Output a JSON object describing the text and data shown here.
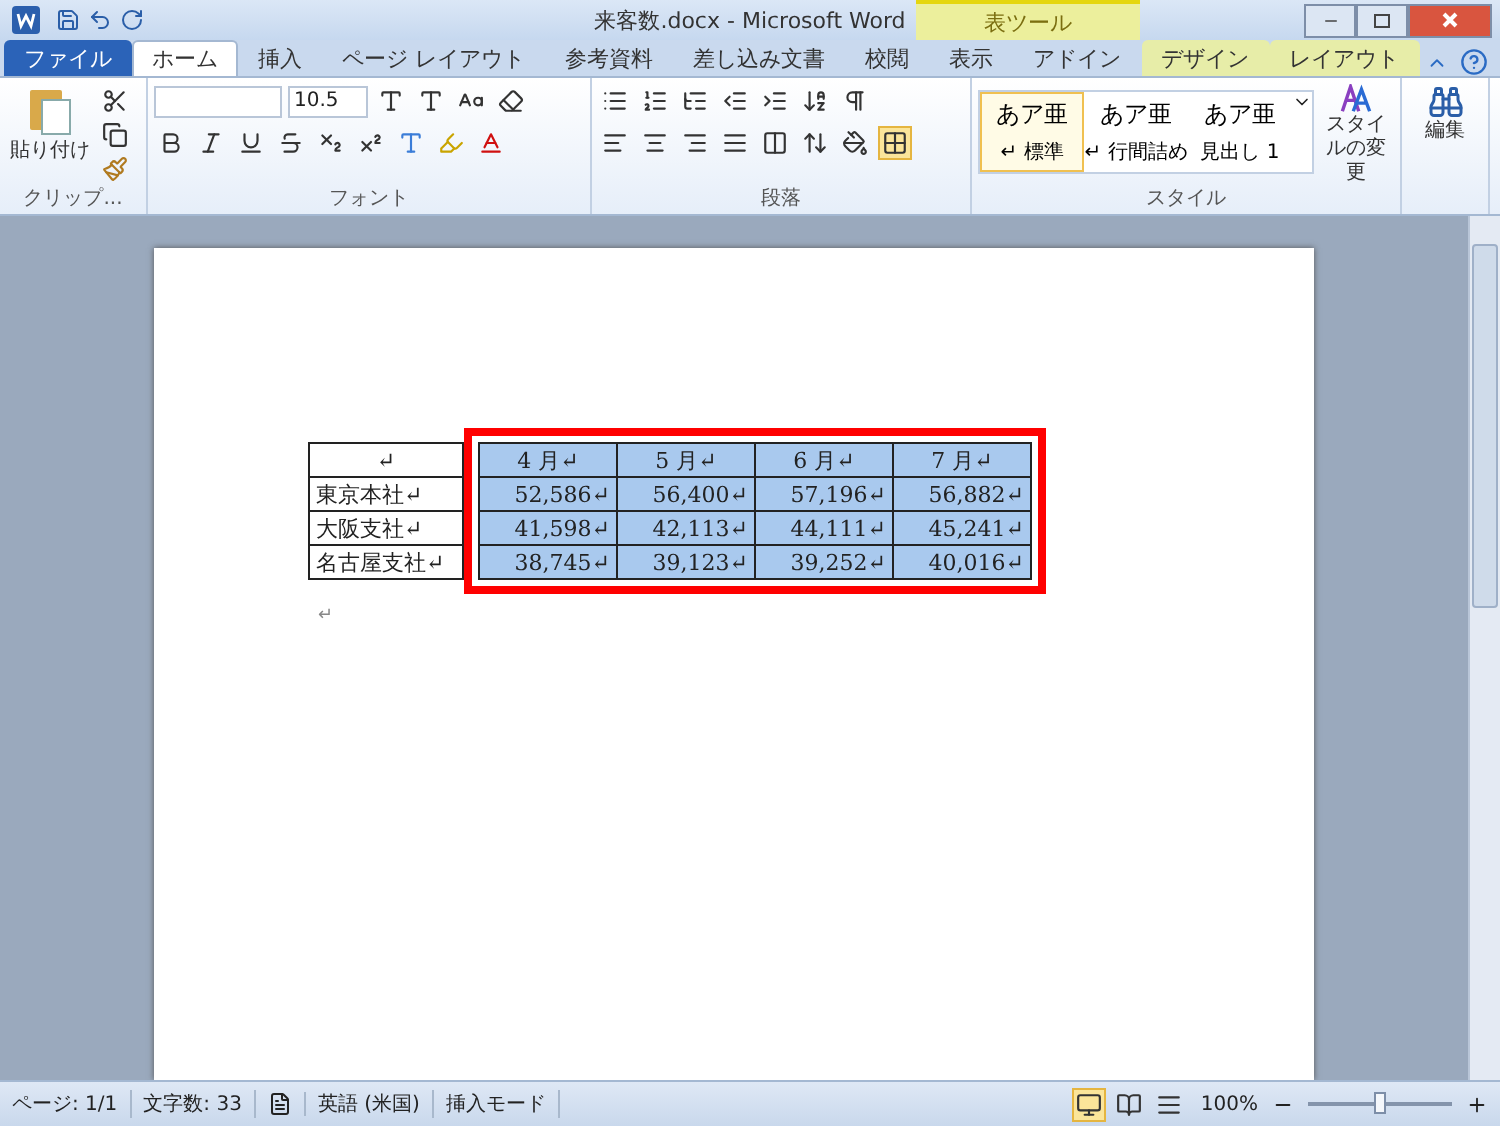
{
  "window": {
    "title": "来客数.docx - Microsoft Word"
  },
  "contextual_header": {
    "label": "表ツール"
  },
  "tabs": [
    {
      "label": "ファイル",
      "kind": "file",
      "selected": false
    },
    {
      "label": "ホーム",
      "kind": "normal",
      "selected": true
    },
    {
      "label": "挿入",
      "kind": "normal",
      "selected": false
    },
    {
      "label": "ページ レイアウト",
      "kind": "normal",
      "selected": false
    },
    {
      "label": "参考資料",
      "kind": "normal",
      "selected": false
    },
    {
      "label": "差し込み文書",
      "kind": "normal",
      "selected": false
    },
    {
      "label": "校閲",
      "kind": "normal",
      "selected": false
    },
    {
      "label": "表示",
      "kind": "normal",
      "selected": false
    },
    {
      "label": "アドイン",
      "kind": "normal",
      "selected": false
    },
    {
      "label": "デザイン",
      "kind": "contextual",
      "selected": false
    },
    {
      "label": "レイアウト",
      "kind": "contextual",
      "selected": false
    }
  ],
  "ribbon": {
    "clipboard": {
      "paste": "貼り付け",
      "label": "クリップ..."
    },
    "font": {
      "size": "10.5",
      "label": "フォント"
    },
    "paragraph": {
      "label": "段落"
    },
    "styles": {
      "items": [
        {
          "sample": "あア亜",
          "name": "↵ 標準",
          "selected": true
        },
        {
          "sample": "あア亜",
          "name": "↵ 行間詰め",
          "selected": false
        },
        {
          "sample": "あア亜",
          "name": "見出し 1",
          "selected": false
        }
      ],
      "change": "スタイルの変更",
      "label": "スタイル"
    },
    "editing": {
      "label": "編集"
    }
  },
  "table": {
    "header": [
      {
        "text": "↵",
        "selected": false
      },
      {
        "text": "4 月↵",
        "selected": true
      },
      {
        "text": "5 月↵",
        "selected": true
      },
      {
        "text": "6 月↵",
        "selected": true
      },
      {
        "text": "7 月↵",
        "selected": true
      }
    ],
    "rows": [
      [
        {
          "text": "東京本社↵",
          "selected": false
        },
        {
          "text": "52,586↵",
          "selected": true
        },
        {
          "text": "56,400↵",
          "selected": true
        },
        {
          "text": "57,196↵",
          "selected": true
        },
        {
          "text": "56,882↵",
          "selected": true
        }
      ],
      [
        {
          "text": "大阪支社↵",
          "selected": false
        },
        {
          "text": "41,598↵",
          "selected": true
        },
        {
          "text": "42,113↵",
          "selected": true
        },
        {
          "text": "44,111↵",
          "selected": true
        },
        {
          "text": "45,241↵",
          "selected": true
        }
      ],
      [
        {
          "text": "名古屋支社↵",
          "selected": false
        },
        {
          "text": "38,745↵",
          "selected": true
        },
        {
          "text": "39,123↵",
          "selected": true
        },
        {
          "text": "39,252↵",
          "selected": true
        },
        {
          "text": "40,016↵",
          "selected": true
        }
      ]
    ],
    "after_mark": "↵"
  },
  "annotation": {
    "kind": "outline",
    "color": "#ff0000"
  },
  "status_bar": {
    "page": "ページ: 1/1",
    "words": "文字数: 33",
    "language": "英語 (米国)",
    "mode": "挿入モード",
    "zoom": "100%",
    "zoom_slider": {
      "level": 0.5
    }
  }
}
